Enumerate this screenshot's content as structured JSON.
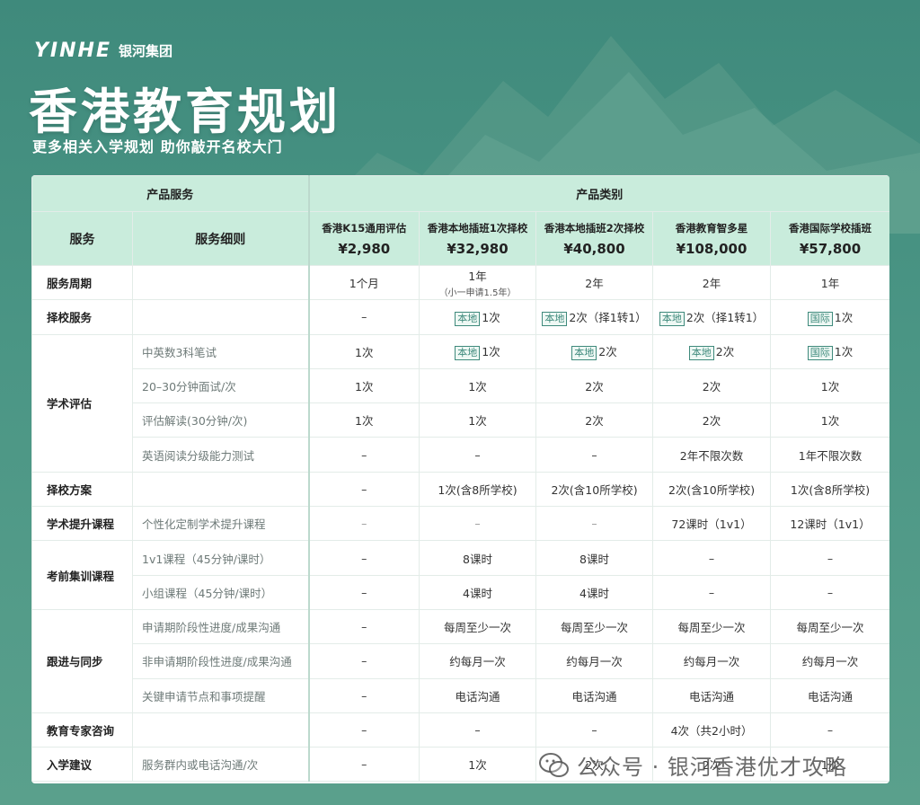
{
  "brand": {
    "logo": "YINHE",
    "name": "银河集团"
  },
  "title": "香港教育规划",
  "subtitle": "更多相关入学规划 助你敲开名校大门",
  "table": {
    "group_headers": {
      "service": "产品服务",
      "category": "产品类别"
    },
    "col_headers": {
      "service": "服务",
      "detail": "服务细则"
    },
    "products": [
      {
        "name": "香港K15通用评估",
        "price": "¥2,980"
      },
      {
        "name": "香港本地插班1次择校",
        "price": "¥32,980"
      },
      {
        "name": "香港本地插班2次择校",
        "price": "¥40,800"
      },
      {
        "name": "香港教育智多星",
        "price": "¥108,000"
      },
      {
        "name": "香港国际学校插班",
        "price": "¥57,800"
      }
    ],
    "tags": {
      "local": "本地",
      "intl": "国际"
    },
    "rows": {
      "period": {
        "service": "服务周期",
        "v1": "1个月",
        "v2": "1年",
        "v2_note": "（小一申请1.5年）",
        "v3": "2年",
        "v4": "2年",
        "v5": "1年"
      },
      "choose": {
        "service": "择校服务",
        "v1": "–",
        "v2": "1次",
        "v3": "2次（择1转1）",
        "v4": "2次（择1转1）",
        "v5": "1次"
      },
      "academic": {
        "service": "学术评估",
        "r1": {
          "detail": "中英数3科笔试",
          "v1": "1次",
          "v2": "1次",
          "v3": "2次",
          "v4": "2次",
          "v5": "1次"
        },
        "r2": {
          "detail": "20–30分钟面试/次",
          "v1": "1次",
          "v2": "1次",
          "v3": "2次",
          "v4": "2次",
          "v5": "1次"
        },
        "r3": {
          "detail": "评估解读(30分钟/次)",
          "v1": "1次",
          "v2": "1次",
          "v3": "2次",
          "v4": "2次",
          "v5": "1次"
        },
        "r4": {
          "detail": "英语阅读分级能力测试",
          "v1": "–",
          "v2": "–",
          "v3": "–",
          "v4": "2年不限次数",
          "v5": "1年不限次数"
        }
      },
      "plan": {
        "service": "择校方案",
        "v1": "–",
        "v2": "1次(含8所学校)",
        "v3": "2次(含10所学校)",
        "v4": "2次(含10所学校)",
        "v5": "1次(含8所学校)"
      },
      "improve": {
        "service": "学术提升课程",
        "detail": "个性化定制学术提升课程",
        "v1": "–",
        "v2": "–",
        "v3": "–",
        "v4": "72课时（1v1）",
        "v5": "12课时（1v1）"
      },
      "training": {
        "service": "考前集训课程",
        "r1": {
          "detail": "1v1课程（45分钟/课时）",
          "v1": "–",
          "v2": "8课时",
          "v3": "8课时",
          "v4": "–",
          "v5": "–"
        },
        "r2": {
          "detail": "小组课程（45分钟/课时）",
          "v1": "–",
          "v2": "4课时",
          "v3": "4课时",
          "v4": "–",
          "v5": "–"
        }
      },
      "follow": {
        "service": "跟进与同步",
        "r1": {
          "detail": "申请期阶段性进度/成果沟通",
          "v1": "–",
          "v2": "每周至少一次",
          "v3": "每周至少一次",
          "v4": "每周至少一次",
          "v5": "每周至少一次"
        },
        "r2": {
          "detail": "非申请期阶段性进度/成果沟通",
          "v1": "–",
          "v2": "约每月一次",
          "v3": "约每月一次",
          "v4": "约每月一次",
          "v5": "约每月一次"
        },
        "r3": {
          "detail": "关键申请节点和事项提醒",
          "v1": "–",
          "v2": "电话沟通",
          "v3": "电话沟通",
          "v4": "电话沟通",
          "v5": "电话沟通"
        }
      },
      "expert": {
        "service": "教育专家咨询",
        "v1": "–",
        "v2": "–",
        "v3": "–",
        "v4": "4次（共2小时）",
        "v5": "–"
      },
      "advice": {
        "service": "入学建议",
        "detail": "服务群内或电话沟通/次",
        "v1": "–",
        "v2": "1次",
        "v3": "2次",
        "v4": "2次",
        "v5": "1次"
      }
    }
  },
  "watermark": "公众号 · 银河香港优才攻略"
}
